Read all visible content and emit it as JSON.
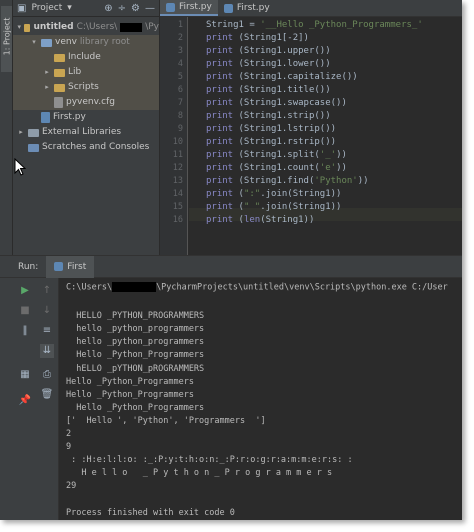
{
  "leftstrip": {
    "tab_label": "1: Project"
  },
  "project": {
    "header": {
      "title": "Project",
      "dropdown": "▾"
    },
    "tree": [
      {
        "label": "untitled",
        "extra": "C:\\Users\\",
        "extra2": "\\Py",
        "depth": 0,
        "type": "folder",
        "arrow": "▾"
      },
      {
        "label": "venv",
        "extra": "library root",
        "depth": 1,
        "type": "folder",
        "arrow": "▾"
      },
      {
        "label": "Include",
        "depth": 2,
        "type": "folder",
        "arrow": ""
      },
      {
        "label": "Lib",
        "depth": 2,
        "type": "folder",
        "arrow": "▸"
      },
      {
        "label": "Scripts",
        "depth": 2,
        "type": "folder",
        "arrow": "▸"
      },
      {
        "label": "pyvenv.cfg",
        "depth": 2,
        "type": "file",
        "arrow": ""
      },
      {
        "label": "First.py",
        "depth": 1,
        "type": "pyfile",
        "arrow": ""
      },
      {
        "label": "External Libraries",
        "depth": 0,
        "type": "lib",
        "arrow": "▸"
      },
      {
        "label": "Scratches and Consoles",
        "depth": 0,
        "type": "scratch",
        "arrow": ""
      }
    ]
  },
  "editor": {
    "tabs": [
      {
        "label": "First.py"
      },
      {
        "label": "First.py"
      }
    ],
    "line_numbers": [
      "1",
      "2",
      "3",
      "4",
      "5",
      "6",
      "7",
      "8",
      "9",
      "10",
      "11",
      "12",
      "13",
      "14",
      "15",
      "16"
    ],
    "lines": [
      "String1 = '__Hello _Python_Programmers_'",
      "print (String1[-2])",
      "print (String1.upper())",
      "print (String1.lower())",
      "print (String1.capitalize())",
      "print (String1.title())",
      "print (String1.swapcase())",
      "print (String1.strip())",
      "print (String1.lstrip())",
      "print (String1.rstrip())",
      "print (String1.split('_'))",
      "print (String1.count('e'))",
      "print (String1.find('Python'))",
      "print (\":\".join(String1))",
      "print (\" \".join(String1))",
      "print (len(String1))"
    ]
  },
  "run": {
    "label": "Run:",
    "tab": "First",
    "command_pre": "C:\\Users\\",
    "command_post": "\\PycharmProjects\\untitled\\venv\\Scripts\\python.exe C:/User",
    "output": [
      "",
      "  HELLO _PYTHON_PROGRAMMERS",
      "  hello _python_programmers",
      "  hello _python_programmers",
      "  Hello _Python_Programmers",
      "  hELLO _pYTHON_pROGRAMMERS",
      "Hello _Python_Programmers",
      "Hello _Python_Programmers",
      "  Hello _Python_Programmers",
      "['  Hello ', 'Python', 'Programmers  ']",
      "2",
      "9",
      " : :H:e:l:l:o: :_:P:y:t:h:o:n:_:P:r:o:g:r:a:m:m:e:r:s: :",
      "   H e l l o   _ P y t h o n _ P r o g r a m m e r s",
      "29",
      "",
      "Process finished with exit code 0"
    ]
  }
}
